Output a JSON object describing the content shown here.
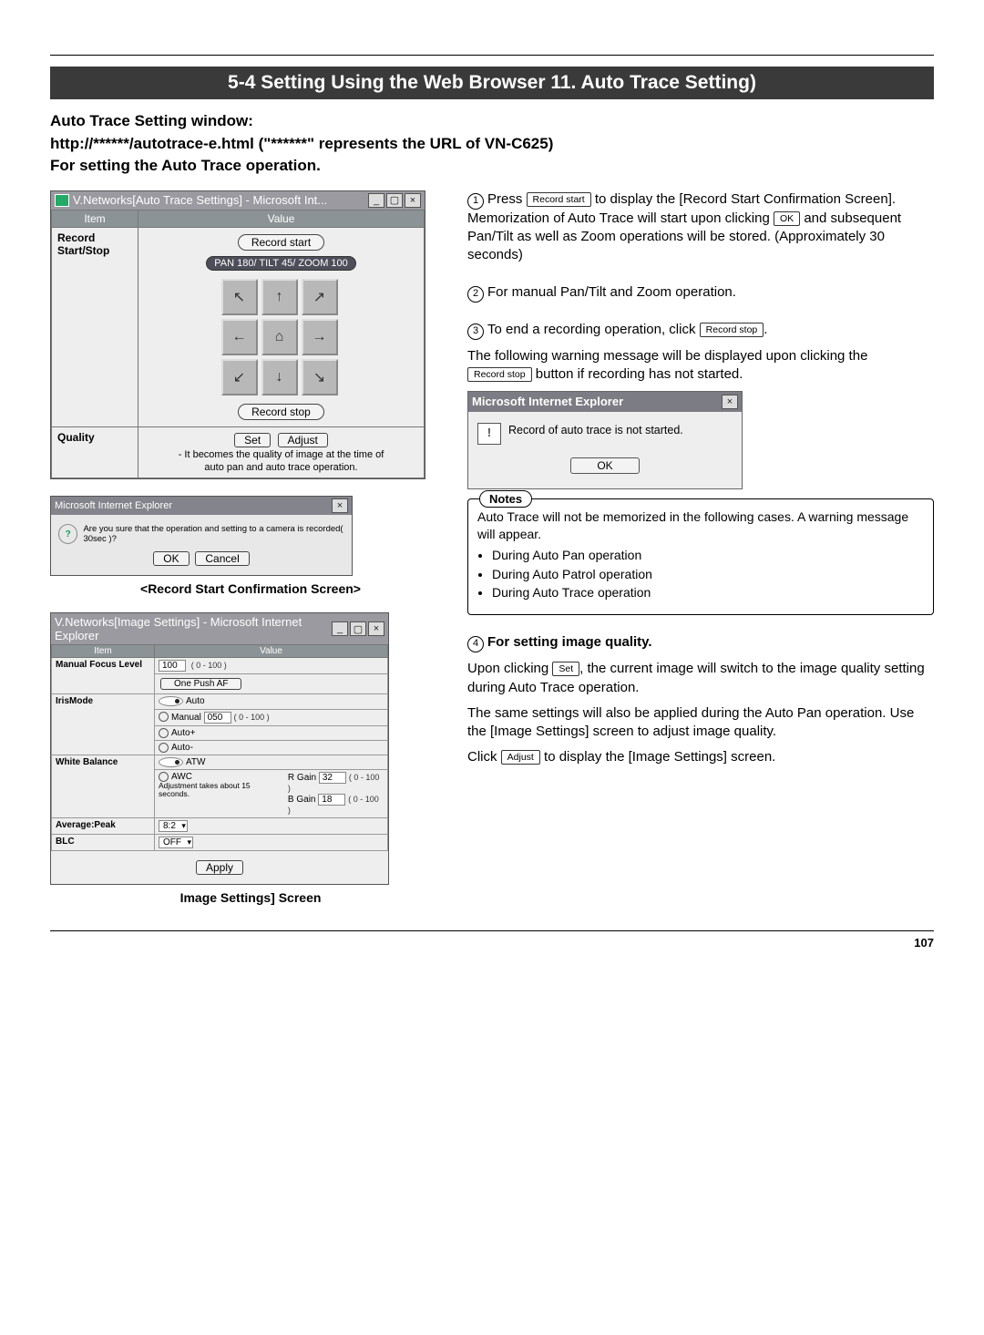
{
  "page_number": "107",
  "section_title": "5-4 Setting Using the Web Browser 11. Auto Trace Setting)",
  "intro_lines": {
    "l1": "Auto Trace Setting window:",
    "l2": "http://******/autotrace-e.html (\"******\" represents the URL of VN-C625)",
    "l3": "For setting the Auto Trace operation."
  },
  "at_window": {
    "title": "V.Networks[Auto Trace Settings] - Microsoft Int...",
    "hdr_item": "Item",
    "hdr_value": "Value",
    "row1_label": "Record\nStart/Stop",
    "record_start": "Record start",
    "position": "PAN 180/ TILT 45/ ZOOM 100",
    "record_stop": "Record stop",
    "row2_label": "Quality",
    "set_btn": "Set",
    "adjust_btn": "Adjust",
    "quality_note1": "- It becomes the quality of image at the time of",
    "quality_note2": "auto pan and auto trace operation."
  },
  "confirm_dialog": {
    "title": "Microsoft Internet Explorer",
    "msg": "Are you sure that the operation and setting to a camera is recorded( 30sec )?",
    "ok": "OK",
    "cancel": "Cancel"
  },
  "confirm_caption": "<Record Start Confirmation Screen>",
  "img_window": {
    "title": "V.Networks[Image Settings] - Microsoft Internet Explorer",
    "hdr_item": "Item",
    "hdr_value": "Value",
    "rows": {
      "mfl": "Manual Focus Level",
      "iris": "IrisMode",
      "wb": "White Balance",
      "ap": "Average:Peak",
      "blc": "BLC"
    },
    "vals": {
      "mfl_val": "100",
      "range_100": "( 0 - 100 )",
      "one_push": "One Push AF",
      "auto": "Auto",
      "manual": "Manual",
      "manual_val": "050",
      "autop": "Auto+",
      "autom": "Auto-",
      "atw": "ATW",
      "awc": "AWC",
      "adj_note": "Adjustment takes about 15 seconds.",
      "rgain": "R Gain",
      "bgain": "B Gain",
      "r_val": "32",
      "b_val": "18",
      "ap_val": "8:2",
      "blc_val": "OFF"
    },
    "apply": "Apply"
  },
  "img_caption": "Image Settings] Screen",
  "right": {
    "s1_a": "Press ",
    "s1_chip": "Record start",
    "s1_b": " to display the [Record Start Confirmation Screen]. Memorization of Auto Trace will start upon clicking ",
    "s1_ok": "OK",
    "s1_c": " and subsequent Pan/Tilt as well as Zoom operations will be stored. (Approximately 30 seconds)",
    "s2": "For manual Pan/Tilt and Zoom operation.",
    "s3_a": "To end a recording operation, click ",
    "s3_chip": "Record stop",
    "s3_b": ".",
    "s3_c": "The following warning message will be displayed upon clicking the ",
    "s3_d": " button if recording has not started.",
    "warn_dialog": {
      "title": "Microsoft Internet Explorer",
      "msg": "Record of auto trace is not started.",
      "ok": "OK"
    },
    "notes_label": "Notes",
    "notes_lead": "Auto Trace will not be memorized in the following cases. A warning message will appear.",
    "notes_items": [
      "During Auto Pan operation",
      "During Auto Patrol operation",
      "During Auto Trace operation"
    ],
    "s4_head": "For setting image quality.",
    "s4_a": "Upon clicking ",
    "s4_set": "Set",
    "s4_b": ", the current image will switch to the image quality setting during Auto Trace operation.",
    "s4_c": "The same settings will also be applied during the Auto Pan operation. Use the [Image Settings] screen to adjust image quality.",
    "s4_d1": "Click ",
    "s4_adjust": "Adjust",
    "s4_d2": " to display the [Image Settings] screen."
  }
}
